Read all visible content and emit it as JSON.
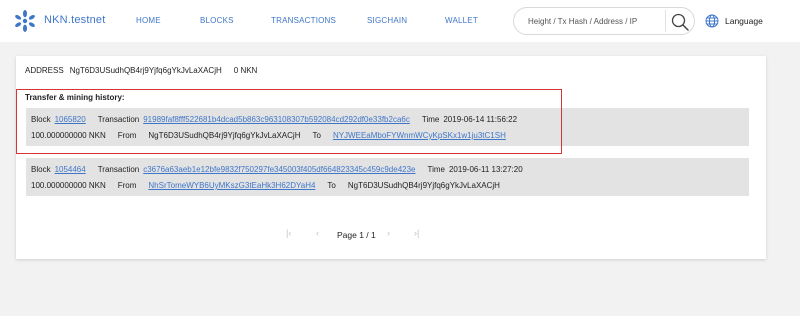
{
  "header": {
    "brand": "NKN.testnet",
    "nav": [
      {
        "label": "HOME"
      },
      {
        "label": "BLOCKS"
      },
      {
        "label": "TRANSACTIONS"
      },
      {
        "label": "SIGCHAIN"
      },
      {
        "label": "WALLET"
      }
    ],
    "search": {
      "placeholder": "Height / Tx Hash / Address / IP",
      "value": ""
    },
    "language_label": "Language"
  },
  "address": {
    "label": "ADDRESS",
    "value": "NgT6D3USudhQB4rj9Yjfq6gYkJvLaXACjH",
    "balance": "0 NKN"
  },
  "history": {
    "title": "Transfer & mining history:",
    "labels": {
      "block": "Block",
      "transaction": "Transaction",
      "time": "Time",
      "from": "From",
      "to": "To"
    },
    "items": [
      {
        "block": "1065820",
        "transaction": "91989faf8fff522681b4dcad5b863c963108307b592084cd292df0e33fb2ca6c",
        "time": "2019-06-14 11:56:22",
        "amount": "100.000000000 NKN",
        "from": "NgT6D3USudhQB4rj9Yjfq6gYkJvLaXACjH",
        "to": "NYJWEEaMboFYWnmWCyKpSKx1w1ju3tC1SH"
      },
      {
        "block": "1054464",
        "transaction": "c3676a63aeb1e12bfe9832f750297fe345003f405df664823345c459c9de423e",
        "time": "2019-06-11 13:27:20",
        "amount": "100.000000000 NKN",
        "from": "NhSrTomeWYB6UyMKszG3tEaHk3H62DYaH4",
        "to": "NgT6D3USudhQB4rj9Yjfq6gYkJvLaXACjH"
      }
    ]
  },
  "pagination": {
    "text": "Page 1 / 1"
  },
  "colors": {
    "accent": "#3f76c8",
    "highlight": "#d9333a",
    "row_bg": "#e3e3e3"
  }
}
